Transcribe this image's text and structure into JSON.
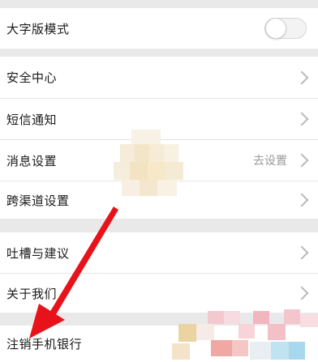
{
  "settings": {
    "large_font_mode": {
      "label": "大字版模式",
      "enabled": false
    },
    "items": [
      {
        "label": "安全中心",
        "value": ""
      },
      {
        "label": "短信通知",
        "value": ""
      },
      {
        "label": "消息设置",
        "value": "去设置"
      },
      {
        "label": "跨渠道设置",
        "value": ""
      },
      {
        "label": "吐槽与建议",
        "value": ""
      },
      {
        "label": "关于我们",
        "value": ""
      }
    ],
    "logout_label": "注销手机银行"
  },
  "colors": {
    "background": "#ececec",
    "row": "#ffffff",
    "arrow": "#e8121a",
    "secondary_text": "#9a9a9a"
  },
  "icons": [
    "chevron-right-icon",
    "toggle-switch"
  ]
}
